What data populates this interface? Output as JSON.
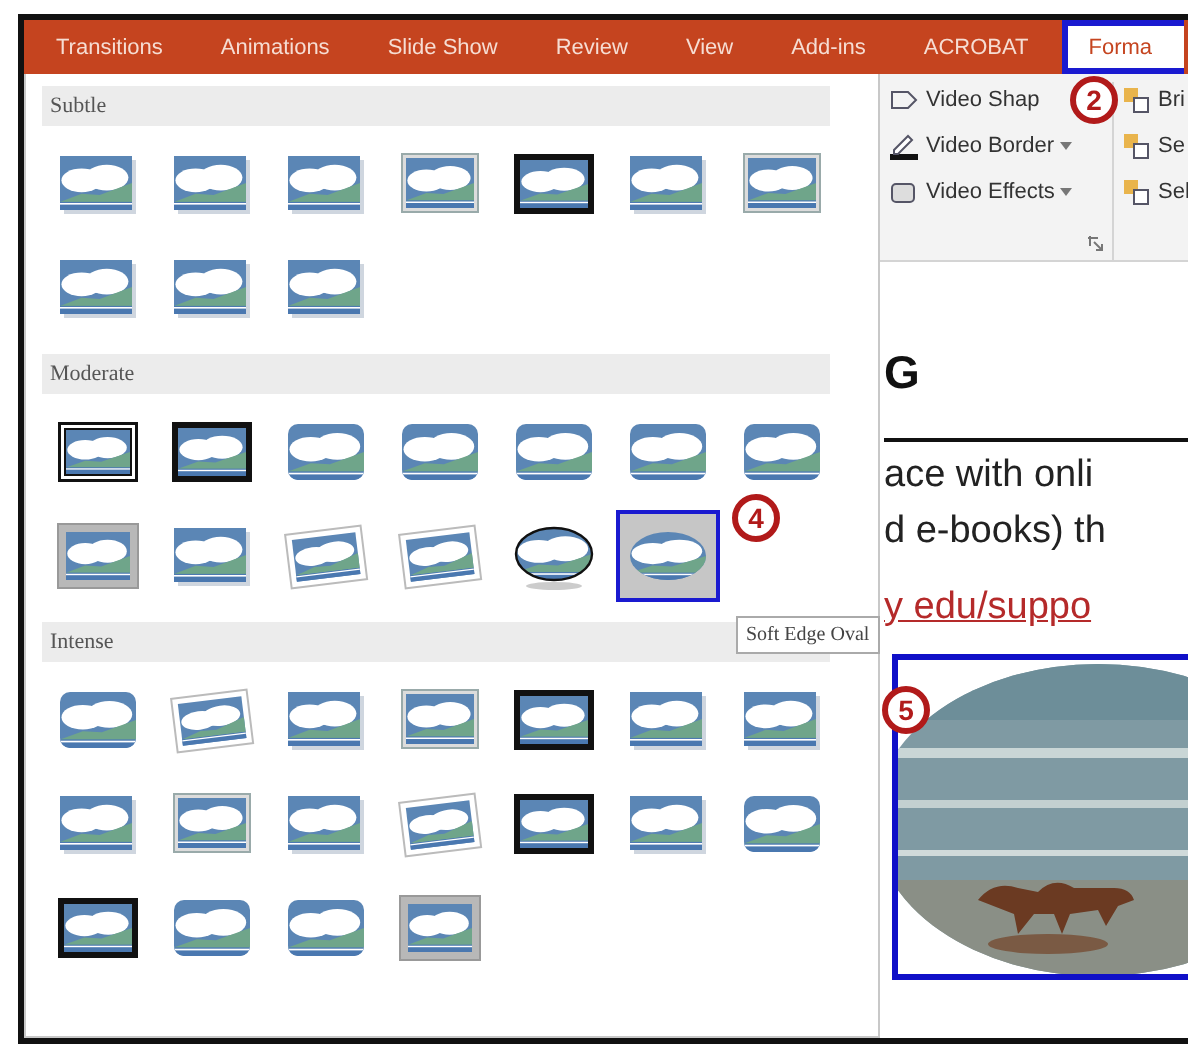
{
  "tabs": [
    {
      "label": "Transitions",
      "selected": false
    },
    {
      "label": "Animations",
      "selected": false
    },
    {
      "label": "Slide Show",
      "selected": false
    },
    {
      "label": "Review",
      "selected": false
    },
    {
      "label": "View",
      "selected": false
    },
    {
      "label": "Add-ins",
      "selected": false
    },
    {
      "label": "ACROBAT",
      "selected": false
    },
    {
      "label": "Forma",
      "selected": true
    }
  ],
  "gallery": {
    "sections": [
      {
        "title": "Subtle",
        "items": [
          {
            "kind": "plain",
            "selected": false
          },
          {
            "kind": "plain",
            "selected": false
          },
          {
            "kind": "plain",
            "selected": false
          },
          {
            "kind": "light-frame",
            "selected": false
          },
          {
            "kind": "thick-frame",
            "selected": false
          },
          {
            "kind": "plain",
            "selected": false
          },
          {
            "kind": "light-frame",
            "selected": false
          },
          {
            "kind": "plain",
            "selected": false
          },
          {
            "kind": "plain",
            "selected": false
          },
          {
            "kind": "plain",
            "selected": false
          }
        ]
      },
      {
        "title": "Moderate",
        "items": [
          {
            "kind": "double-frame",
            "selected": false
          },
          {
            "kind": "thick-frame",
            "selected": false
          },
          {
            "kind": "rounded",
            "selected": false
          },
          {
            "kind": "rounded",
            "selected": false
          },
          {
            "kind": "rounded",
            "selected": false
          },
          {
            "kind": "rounded",
            "selected": false
          },
          {
            "kind": "rounded",
            "selected": false
          },
          {
            "kind": "gray-mat",
            "selected": false
          },
          {
            "kind": "plain",
            "selected": false
          },
          {
            "kind": "rotated",
            "selected": false
          },
          {
            "kind": "rotated",
            "selected": false
          },
          {
            "kind": "oval",
            "selected": false
          },
          {
            "kind": "soft-oval",
            "selected": true
          }
        ]
      },
      {
        "title": "Intense",
        "items": [
          {
            "kind": "rounded",
            "selected": false
          },
          {
            "kind": "rotated",
            "selected": false
          },
          {
            "kind": "plain",
            "selected": false
          },
          {
            "kind": "light-frame",
            "selected": false
          },
          {
            "kind": "thick-frame",
            "selected": false
          },
          {
            "kind": "plain",
            "selected": false
          },
          {
            "kind": "plain",
            "selected": false
          },
          {
            "kind": "plain",
            "selected": false
          },
          {
            "kind": "light-frame",
            "selected": false
          },
          {
            "kind": "plain",
            "selected": false
          },
          {
            "kind": "rotated",
            "selected": false
          },
          {
            "kind": "thick-frame",
            "selected": false
          },
          {
            "kind": "plain",
            "selected": false
          },
          {
            "kind": "rounded",
            "selected": false
          },
          {
            "kind": "thick-frame",
            "selected": false
          },
          {
            "kind": "rounded",
            "selected": false
          },
          {
            "kind": "rounded",
            "selected": false
          },
          {
            "kind": "gray-mat",
            "selected": false
          }
        ]
      }
    ],
    "tooltip": "Soft Edge Oval"
  },
  "ribbon": {
    "commands": [
      {
        "label": "Video Shap",
        "dropdown": false
      },
      {
        "label": "Video Border",
        "dropdown": true
      },
      {
        "label": "Video Effects",
        "dropdown": true
      }
    ],
    "commands_2": [
      {
        "label": "Bri"
      },
      {
        "label": "Se"
      },
      {
        "label": "Sel"
      }
    ]
  },
  "slide": {
    "heading": "G",
    "lines": [
      "ace with onli",
      "d e-books) th"
    ],
    "link": "y edu/suppo",
    "image": {
      "kind": "picture"
    }
  },
  "callouts": [
    {
      "number": "2"
    },
    {
      "number": "4"
    },
    {
      "number": "5"
    }
  ]
}
